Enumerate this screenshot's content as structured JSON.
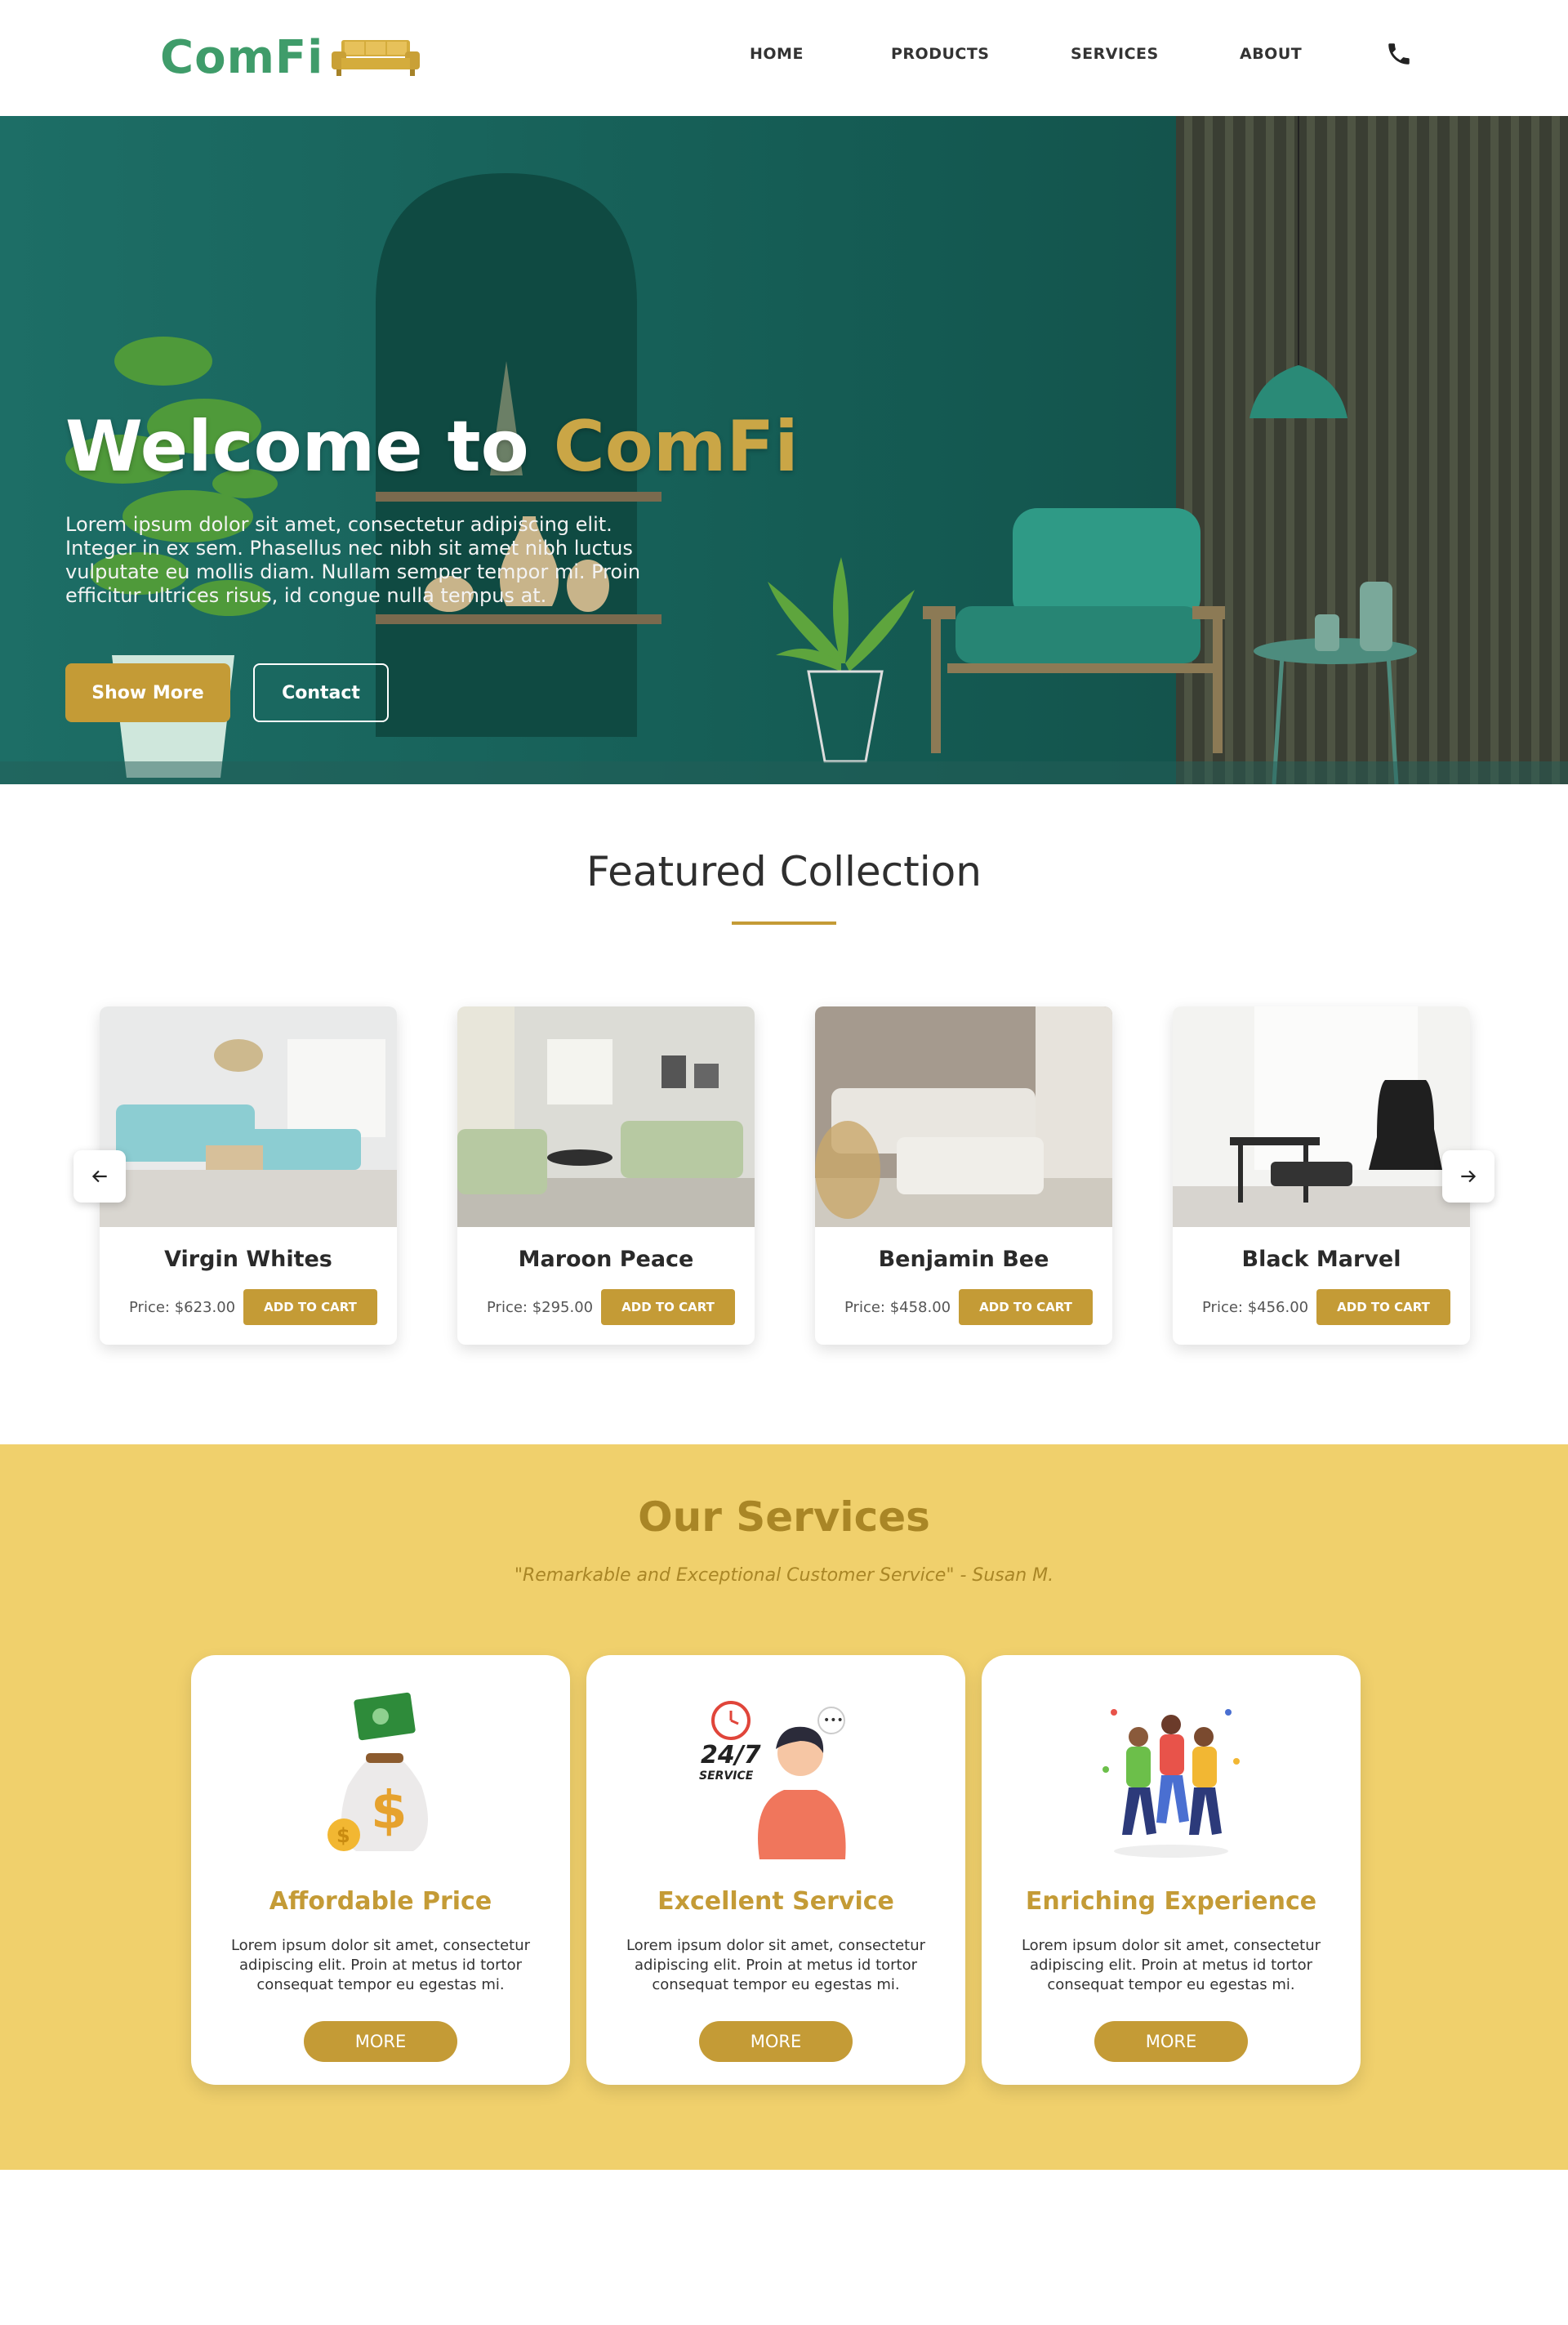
{
  "brand": {
    "name": "ComFi",
    "logo_icon": "sofa-icon",
    "color": "#3f9c6a",
    "accent": "#c49b36"
  },
  "nav": {
    "items": [
      {
        "label": "HOME"
      },
      {
        "label": "PRODUCTS"
      },
      {
        "label": "SERVICES"
      },
      {
        "label": "ABOUT"
      }
    ],
    "phone_icon": "phone-icon"
  },
  "hero": {
    "title_prefix": "Welcome to ",
    "title_brand": "ComFi",
    "text": "Lorem ipsum dolor sit amet, consectetur adipiscing elit. Integer in ex sem. Phasellus nec nibh sit amet nibh luctus vulputate eu mollis diam. Nullam semper tempor mi. Proin efficitur ultrices risus, id congue nulla tempus at.",
    "show_more_label": "Show More",
    "contact_label": "Contact"
  },
  "featured": {
    "title": "Featured Collection",
    "products": [
      {
        "name": "Virgin Whites",
        "price": "Price: $623.00",
        "cart_label": "ADD TO CART"
      },
      {
        "name": "Maroon Peace",
        "price": "Price: $295.00",
        "cart_label": "ADD TO CART"
      },
      {
        "name": "Benjamin Bee",
        "price": "Price: $458.00",
        "cart_label": "ADD TO CART"
      },
      {
        "name": "Black Marvel",
        "price": "Price: $456.00",
        "cart_label": "ADD TO CART"
      }
    ],
    "prev_icon": "arrow-left-icon",
    "next_icon": "arrow-right-icon"
  },
  "services": {
    "title": "Our Services",
    "quote": "\"Remarkable and Exceptional Customer Service\" - Susan M.",
    "background": "#f0d06c",
    "items": [
      {
        "title": "Affordable Price",
        "text": "Lorem ipsum dolor sit amet, consectetur adipiscing elit. Proin at metus id tortor consequat tempor eu egestas mi.",
        "more_label": "MORE",
        "icon": "money-bag-icon"
      },
      {
        "title": "Excellent Service",
        "text": "Lorem ipsum dolor sit amet, consectetur adipiscing elit. Proin at metus id tortor consequat tempor eu egestas mi.",
        "more_label": "MORE",
        "icon": "support-agent-icon",
        "badge_top": "24/7",
        "badge_bottom": "SERVICE"
      },
      {
        "title": "Enriching Experience",
        "text": "Lorem ipsum dolor sit amet, consectetur adipiscing elit. Proin at metus id tortor consequat tempor eu egestas mi.",
        "more_label": "MORE",
        "icon": "celebrating-people-icon"
      }
    ]
  }
}
